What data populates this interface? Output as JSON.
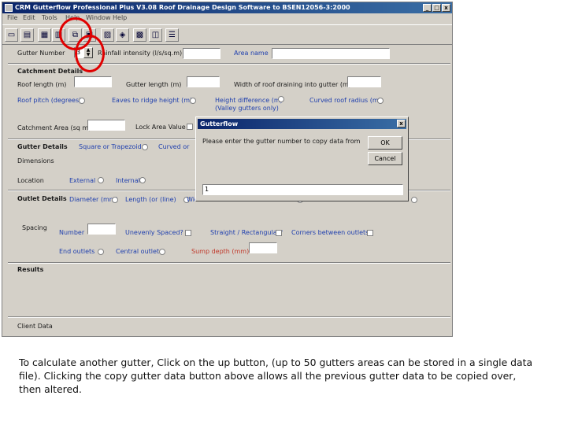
{
  "window": {
    "title": "CRM Gutterflow Professional Plus V3.08 Roof Drainage Design Software to BSEN12056-3:2000",
    "controls": [
      "_",
      "□",
      "x"
    ]
  },
  "menu": [
    "File",
    "Edit",
    "Tools",
    "Help",
    "Window",
    "Help"
  ],
  "toolbar_icons": [
    "open-icon",
    "save-icon",
    "print-icon",
    "print-preview-icon",
    "copy-gutter-data-icon",
    "copy-icon",
    "print2-icon",
    "web-icon",
    "calculator-icon",
    "report-icon",
    "list-icon"
  ],
  "form": {
    "gutter_number_label": "Gutter Number",
    "gutter_number_value": "3",
    "rainfall_label": "Rainfall intensity (l/s/sq.m)",
    "area_name_label": "Area name",
    "catchment_title": "Catchment Details",
    "roof_length": "Roof length (m)",
    "gutter_length": "Gutter length (m)",
    "width_draining": "Width of roof draining into gutter (m)",
    "roof_pitch": "Roof pitch (degrees)",
    "eaves_ridge": "Eaves to ridge height (m)",
    "height_diff": "Height difference (m)",
    "height_diff_sub": "(Valley gutters only)",
    "curved_radius": "Curved roof radius (m)",
    "catchment_area": "Catchment Area (sq m)",
    "lock_area": "Lock Area Value",
    "gutter_title": "Gutter Details",
    "square_trap": "Square or Trapezoidal",
    "curved_or": "Curved or",
    "dimensions": "Dimensions",
    "location": "Location",
    "external": "External",
    "internal": "Internal",
    "outlet_title": "Outlet Details",
    "diameter": "Diameter (mm)",
    "length_rect": "Length (or (line)",
    "width_rect": "Wid",
    "spacing": "Spacing",
    "number": "Number",
    "unevenly": "Unevenly Spaced?",
    "straight": "Straight / Rectangular?",
    "corners": "Corners between outlets",
    "end_outlets": "End outlets",
    "central_outlets": "Central outlets",
    "sump_depth": "Sump depth (mm)",
    "results_title": "Results",
    "client_title": "Client Data"
  },
  "dialog": {
    "title": "Gutterflow",
    "prompt": "Please enter the gutter number to copy data from",
    "ok": "OK",
    "cancel": "Cancel",
    "input_value": "1",
    "close": "x"
  },
  "caption": "To calculate another gutter, Click on the up button, (up to 50 gutters areas can be stored in a single data file). Clicking the copy gutter data button above allows all the previous gutter data to be copied over, then altered.",
  "colors": {
    "label_blue": "#1f3fae",
    "label_red": "#c0392b",
    "highlight_red": "#e00000"
  }
}
